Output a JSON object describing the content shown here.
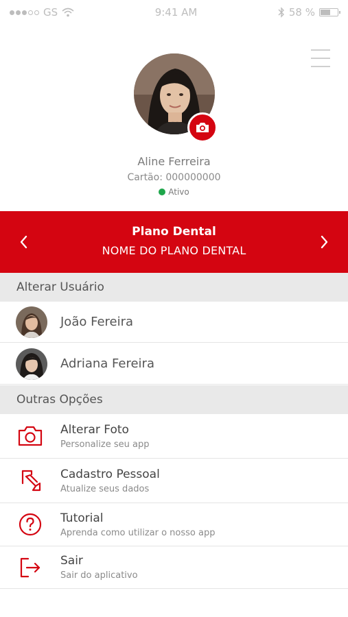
{
  "status_bar": {
    "carrier": "GS",
    "time": "9:41 AM",
    "battery_percent": "58 %",
    "battery_level": 0.58
  },
  "profile": {
    "name": "Aline Ferreira",
    "card": "Cartão: 000000000",
    "status": "Ativo",
    "status_color": "#1ea64b"
  },
  "plan": {
    "title": "Plano Dental",
    "name": "NOME DO PLANO DENTAL",
    "color": "#d40511"
  },
  "switch_user": {
    "header": "Alterar Usuário",
    "users": [
      {
        "name": "João Fereira"
      },
      {
        "name": "Adriana Fereira"
      }
    ]
  },
  "other_options": {
    "header": "Outras Opções",
    "items": [
      {
        "icon": "camera-icon",
        "title": "Alterar Foto",
        "subtitle": "Personalize seu app"
      },
      {
        "icon": "edit-icon",
        "title": "Cadastro Pessoal",
        "subtitle": "Atualize seus dados"
      },
      {
        "icon": "help-icon",
        "title": "Tutorial",
        "subtitle": "Aprenda como utilizar o nosso app"
      },
      {
        "icon": "logout-icon",
        "title": "Sair",
        "subtitle": "Sair do aplicativo"
      }
    ]
  }
}
